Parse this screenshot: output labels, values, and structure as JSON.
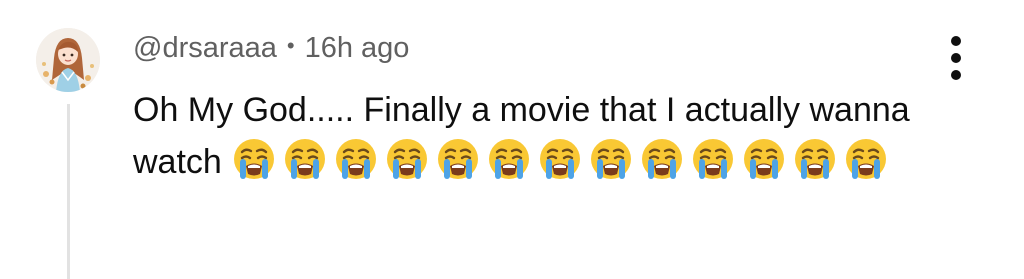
{
  "comment": {
    "author": "@drsaraaa",
    "separator": "•",
    "timestamp": "16h ago",
    "text": "Oh My God..... Finally a movie that I actually wanna watch",
    "emoji_name": "loudly-crying-face",
    "emoji_count": 13
  },
  "avatar": {
    "icon": "illustrated-girl-avatar"
  },
  "actions": {
    "more_icon": "vertical-ellipsis-icon"
  },
  "colors": {
    "meta_text": "#606060",
    "body_text": "#0f0f0f",
    "thread_line": "#e2e2e2",
    "emoji_yellow": "#f9c834",
    "emoji_tears": "#4ea3e6"
  }
}
